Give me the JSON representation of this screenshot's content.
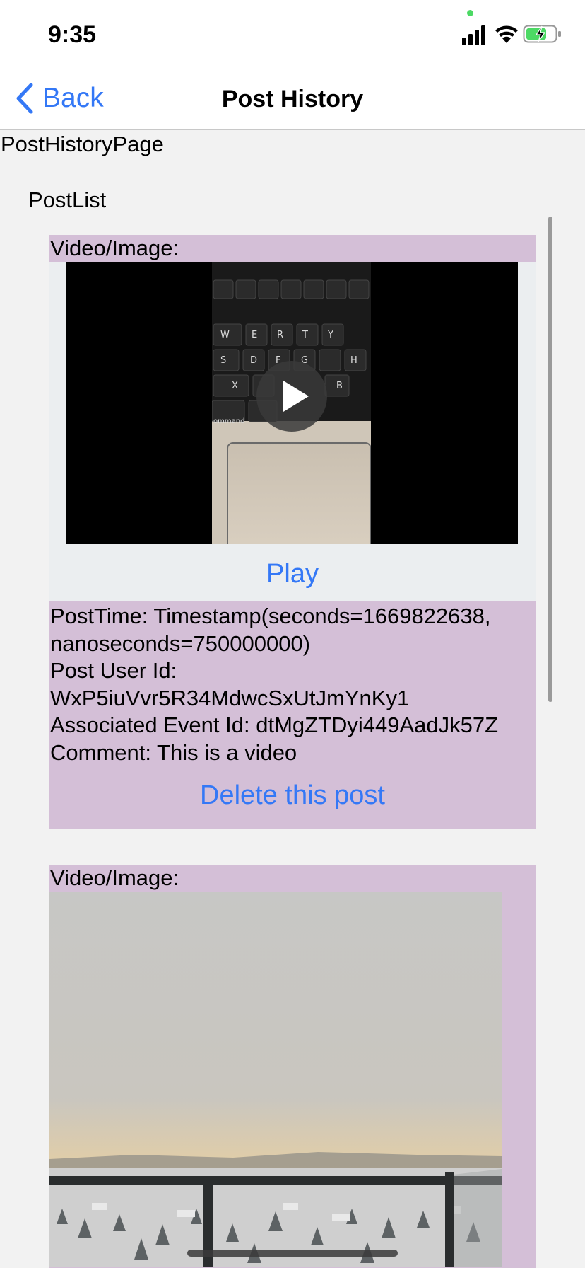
{
  "status_bar": {
    "time": "9:35",
    "icons": [
      "signal-icon",
      "wifi-icon",
      "battery-charging-icon"
    ]
  },
  "nav": {
    "back_label": "Back",
    "title": "Post History"
  },
  "page": {
    "page_label": "PostHistoryPage",
    "list_label": "PostList"
  },
  "posts": [
    {
      "media_label": "Video/Image:",
      "play_label": "Play",
      "post_time": "PostTime: Timestamp(seconds=1669822638,",
      "post_time_cont": "nanoseconds=750000000)",
      "user_id_label": "Post User Id:",
      "user_id": "WxP5iuVvr5R34MdwcSxUtJmYnKy1",
      "event_id": "Associated Event Id: dtMgZTDyi449AadJk57Z",
      "comment": "Comment: This is a video",
      "delete_label": "Delete this post"
    },
    {
      "media_label": "Video/Image:"
    }
  ],
  "colors": {
    "accent": "#3478f6",
    "card_background": "#d4bfd7",
    "video_container": "#ebeef0",
    "page_background": "#f2f2f2"
  }
}
